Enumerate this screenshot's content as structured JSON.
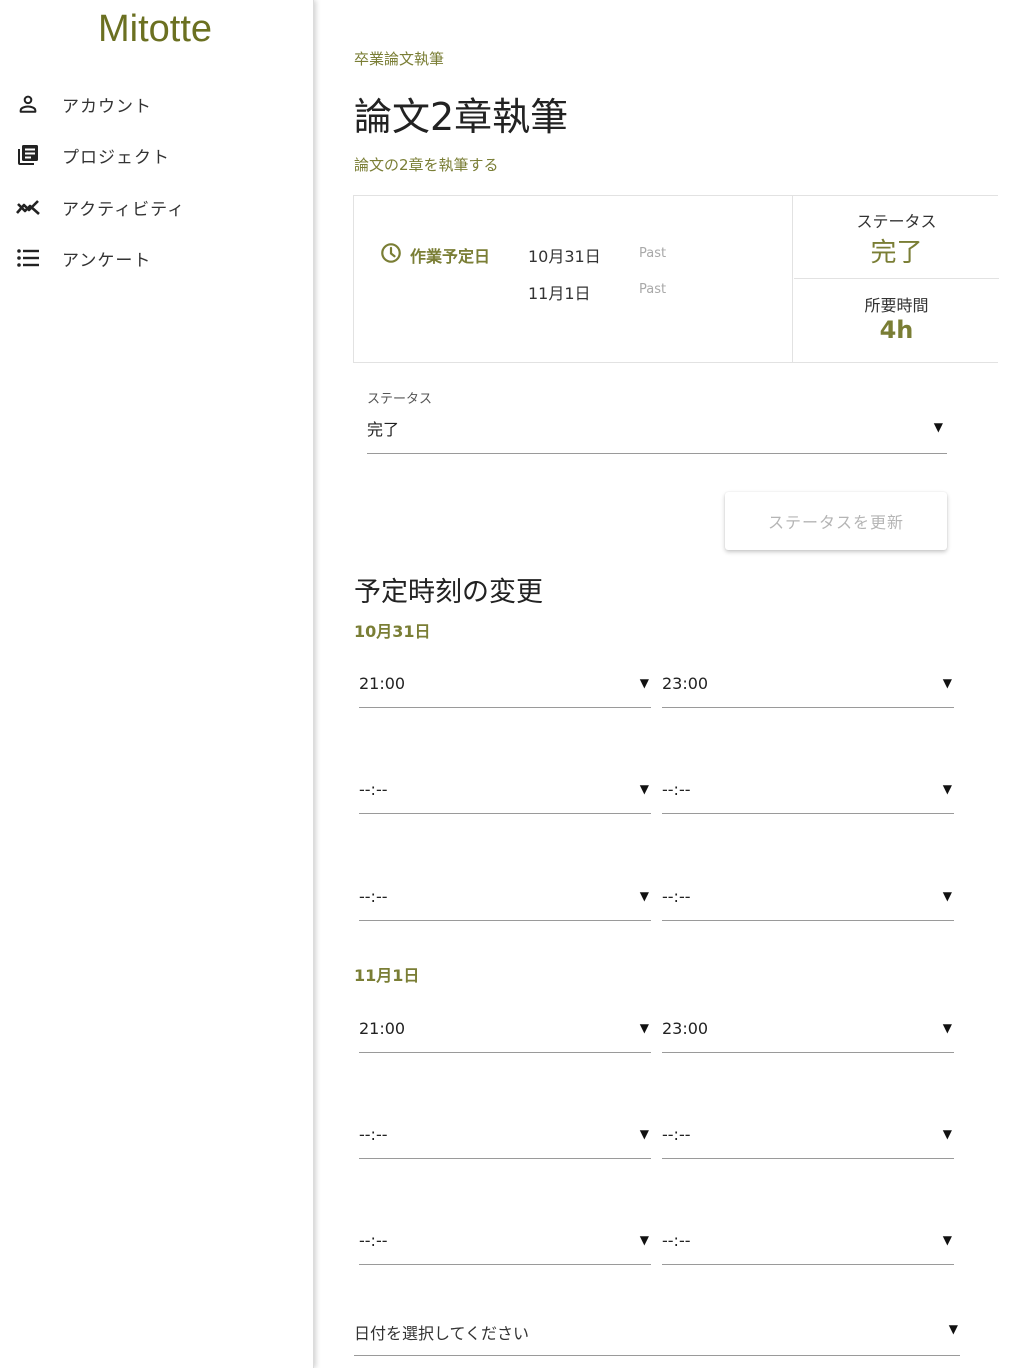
{
  "app": {
    "brand": "Mitotte"
  },
  "sidebar": {
    "items": [
      {
        "label": "アカウント",
        "icon": "account-icon"
      },
      {
        "label": "プロジェクト",
        "icon": "library-books-icon"
      },
      {
        "label": "アクティビティ",
        "icon": "trending-icon"
      },
      {
        "label": "アンケート",
        "icon": "list-icon"
      }
    ]
  },
  "page": {
    "breadcrumb": "卒業論文執筆",
    "title": "論文2章執筆",
    "subtitle": "論文の2章を執筆する"
  },
  "summary": {
    "schedule_label": "作業予定日",
    "dates": [
      {
        "date": "10月31日",
        "tag": "Past"
      },
      {
        "date": "11月1日",
        "tag": "Past"
      }
    ],
    "status_label": "ステータス",
    "status_value": "完了",
    "duration_label": "所要時間",
    "duration_value": "4h"
  },
  "status_form": {
    "label": "ステータス",
    "value": "完了",
    "submit_label": "ステータスを更新"
  },
  "reschedule": {
    "title": "予定時刻の変更",
    "days": [
      {
        "date": "10月31日",
        "slots": [
          {
            "start": "21:00",
            "end": "23:00"
          },
          {
            "start": "--:--",
            "end": "--:--"
          },
          {
            "start": "--:--",
            "end": "--:--"
          }
        ]
      },
      {
        "date": "11月1日",
        "slots": [
          {
            "start": "21:00",
            "end": "23:00"
          },
          {
            "start": "--:--",
            "end": "--:--"
          },
          {
            "start": "--:--",
            "end": "--:--"
          }
        ]
      }
    ],
    "date_picker_placeholder": "日付を選択してください"
  },
  "colors": {
    "accent": "#7a7e35",
    "brand": "#6b7021"
  }
}
